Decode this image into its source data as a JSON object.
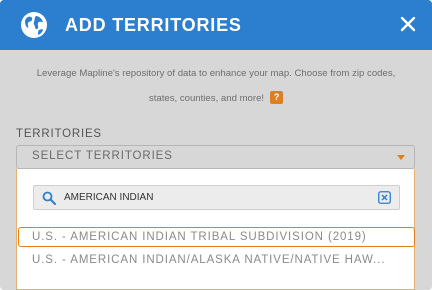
{
  "header": {
    "title": "ADD TERRITORIES",
    "bg_color": "#2b7fce",
    "globe_icon": "globe-icon",
    "close_icon": "close-icon"
  },
  "description": {
    "line1": "Leverage Mapline's repository of data to enhance your map. Choose from zip codes,",
    "line2": "states, counties, and more!",
    "help_label": "?"
  },
  "territories": {
    "label": "TERRITORIES",
    "select_label": "SELECT TERRITORIES",
    "search": {
      "value": "AMERICAN INDIAN",
      "clear_icon": "clear-icon"
    },
    "options": [
      "U.S. - AMERICAN INDIAN TRIBAL SUBDIVISION (2019)",
      "U.S. - AMERICAN INDIAN/ALASKA NATIVE/NATIVE HAW..."
    ]
  },
  "colors": {
    "accent": "#e07f1f",
    "highlight_border": "#e07f1f"
  }
}
